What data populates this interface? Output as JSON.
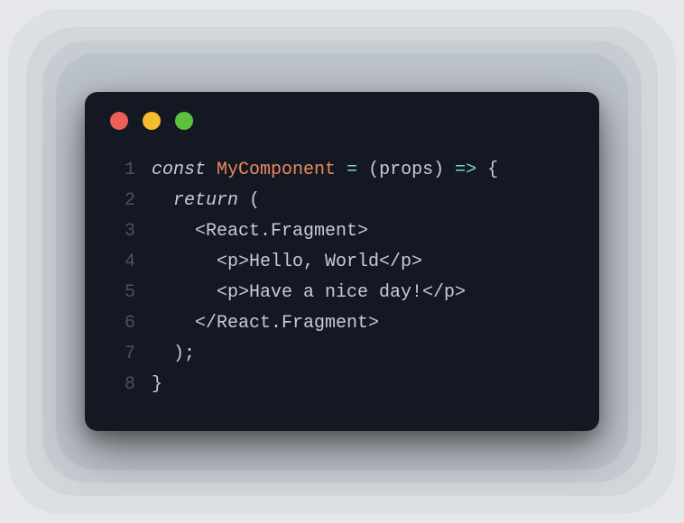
{
  "window": {
    "dots": {
      "red": "#ec5f57",
      "yellow": "#f4bd2c",
      "green": "#5bc13f"
    }
  },
  "code": {
    "lines": [
      {
        "num": "1",
        "tokens": [
          {
            "cls": "kw",
            "t": "const"
          },
          {
            "cls": "content",
            "t": " "
          },
          {
            "cls": "fn",
            "t": "MyComponent"
          },
          {
            "cls": "content",
            "t": " "
          },
          {
            "cls": "op",
            "t": "="
          },
          {
            "cls": "content",
            "t": " (props) "
          },
          {
            "cls": "op",
            "t": "=>"
          },
          {
            "cls": "content",
            "t": " {"
          }
        ]
      },
      {
        "num": "2",
        "tokens": [
          {
            "cls": "content",
            "t": "  "
          },
          {
            "cls": "kw",
            "t": "return"
          },
          {
            "cls": "content",
            "t": " ("
          }
        ]
      },
      {
        "num": "3",
        "tokens": [
          {
            "cls": "content",
            "t": "    <React.Fragment>"
          }
        ]
      },
      {
        "num": "4",
        "tokens": [
          {
            "cls": "content",
            "t": "      <p>Hello, World</p>"
          }
        ]
      },
      {
        "num": "5",
        "tokens": [
          {
            "cls": "content",
            "t": "      <p>Have a nice day!</p>"
          }
        ]
      },
      {
        "num": "6",
        "tokens": [
          {
            "cls": "content",
            "t": "    </React.Fragment>"
          }
        ]
      },
      {
        "num": "7",
        "tokens": [
          {
            "cls": "content",
            "t": "  );"
          }
        ]
      },
      {
        "num": "8",
        "tokens": [
          {
            "cls": "content",
            "t": "}"
          }
        ]
      }
    ]
  }
}
